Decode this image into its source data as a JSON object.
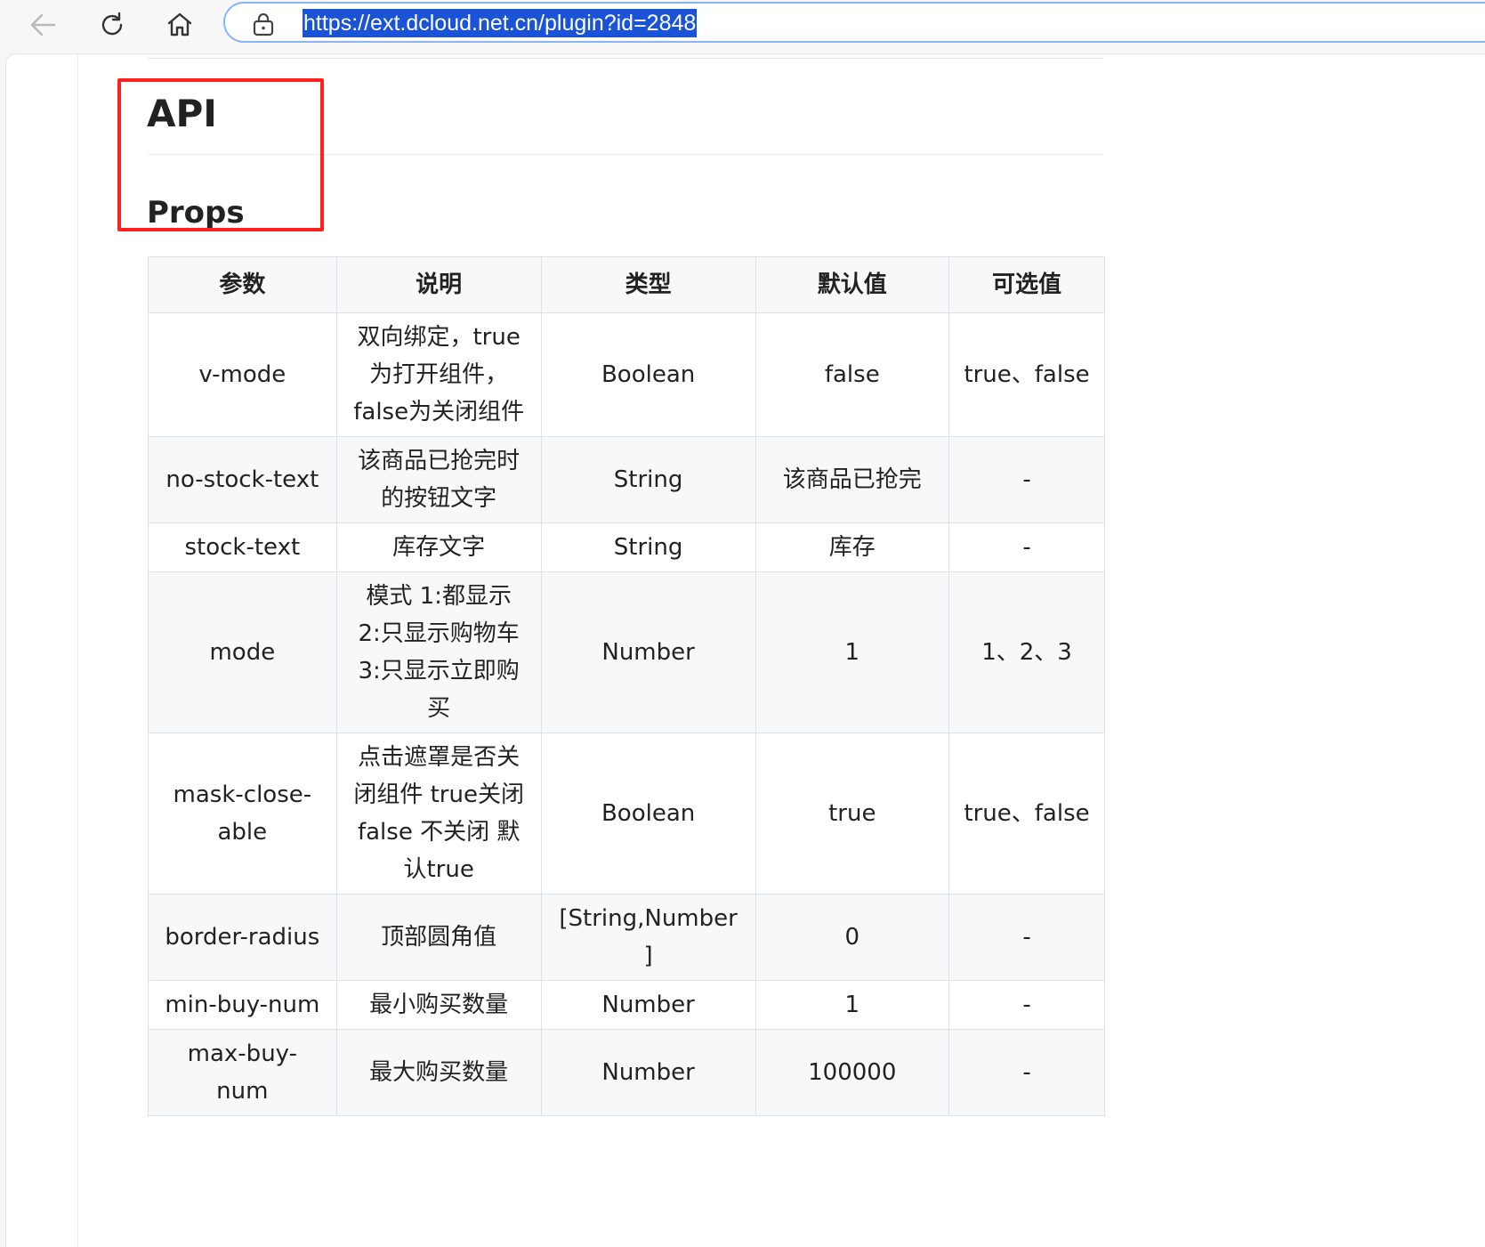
{
  "browser": {
    "url": "https://ext.dcloud.net.cn/plugin?id=2848"
  },
  "content": {
    "heading": "API",
    "subheading": "Props"
  },
  "table": {
    "headers": [
      "参数",
      "说明",
      "类型",
      "默认值",
      "可选值"
    ],
    "rows": [
      [
        "v-mode",
        "双向绑定，true为打开组件，false为关闭组件",
        "Boolean",
        "false",
        "true、false"
      ],
      [
        "no-stock-text",
        "该商品已抢完时的按钮文字",
        "String",
        "该商品已抢完",
        "-"
      ],
      [
        "stock-text",
        "库存文字",
        "String",
        "库存",
        "-"
      ],
      [
        "mode",
        "模式 1:都显示 2:只显示购物车 3:只显示立即购买",
        "Number",
        "1",
        "1、2、3"
      ],
      [
        "mask-close-able",
        "点击遮罩是否关闭组件 true关闭 false 不关闭 默认true",
        "Boolean",
        "true",
        "true、false"
      ],
      [
        "border-radius",
        "顶部圆角值",
        "[String,Number]",
        "0",
        "-"
      ],
      [
        "min-buy-num",
        "最小购买数量",
        "Number",
        "1",
        "-"
      ],
      [
        "max-buy-num",
        "最大购买数量",
        "Number",
        "100000",
        "-"
      ]
    ]
  },
  "colors": {
    "highlight_box": "#ff2020",
    "url_selection": "#1a53d6",
    "address_border": "#8ab4f8"
  }
}
